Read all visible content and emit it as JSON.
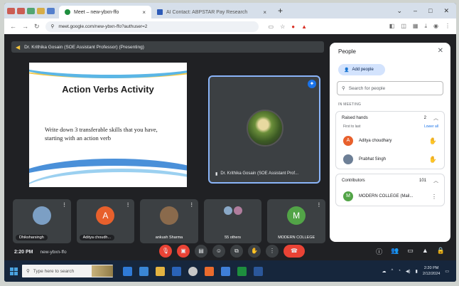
{
  "browser": {
    "tabs": [
      {
        "label": "Meet – new-ybxn-ffo",
        "active": true
      },
      {
        "label": "AI Contact: ABPSTAR Pay Research",
        "active": false
      }
    ],
    "url": "meet.google.com/new-ybxn-ffo?authuser=2"
  },
  "meet": {
    "presenting_banner": "Dr. Krithika Gosain (SOE Assistant Professor) (Presenting)",
    "slide": {
      "title": "Action Verbs Activity",
      "body": "Write down 3 transferable skills that you have, starting with an action verb"
    },
    "speaker_name": "Dr. Krithika Gosain (SOE Assistant Prof...",
    "tiles": [
      {
        "label": "Dhiksharsingh",
        "avatar": "photo",
        "labelled_chip": true
      },
      {
        "label": "Aditya choudh...",
        "avatar": "A",
        "labelled_chip": true
      },
      {
        "label": "ankush Sharma",
        "avatar": "photo",
        "labelled_chip": false
      },
      {
        "label": "55 others",
        "avatar": "group",
        "labelled_chip": false
      },
      {
        "label": "MODERN COLLEGE",
        "avatar": "M",
        "labelled_chip": false
      }
    ],
    "time": "2:20 PM",
    "meeting_code": "new-ybxn-ffo"
  },
  "people_panel": {
    "title": "People",
    "add_people": "Add people",
    "search_placeholder": "Search for people",
    "section_label": "IN MEETING",
    "raised_hands": {
      "label": "Raised hands",
      "count": "2",
      "first_to_last": "First to last",
      "lower_all": "Lower all",
      "people": [
        {
          "initial": "A",
          "name": "Aditya choudhary"
        },
        {
          "initial": "",
          "name": "Prabhat Singh"
        }
      ]
    },
    "contributors": {
      "label": "Contributors",
      "count": "101",
      "people": [
        {
          "initial": "M",
          "name": "MODERN COLLEGE (Mail..."
        }
      ]
    }
  },
  "taskbar": {
    "search_placeholder": "Type here to search",
    "clock_time": "2:20 PM",
    "clock_date": "2/12/2024"
  },
  "colors": {
    "meet_bg": "#202124",
    "tile_bg": "#3c4043",
    "end_call": "#ea4335",
    "accent_blue": "#1a73e8"
  }
}
